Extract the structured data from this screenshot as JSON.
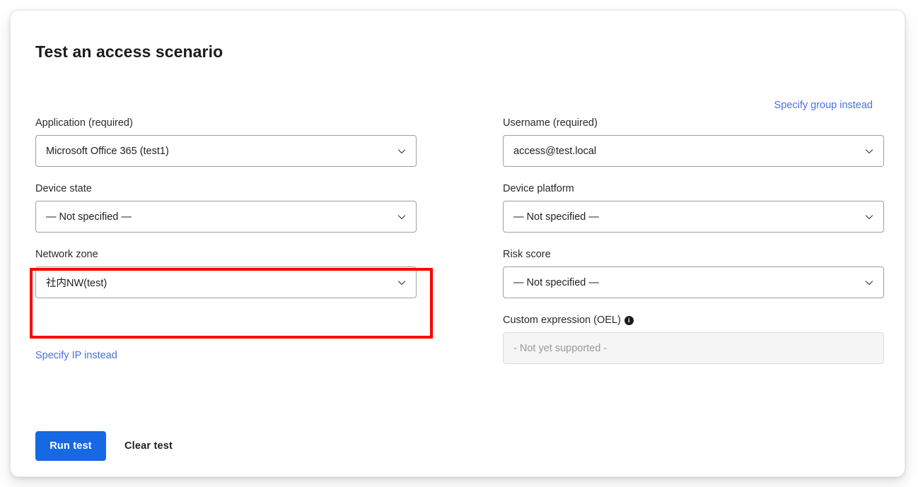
{
  "header": {
    "title": "Test an access scenario"
  },
  "links": {
    "specify_group": "Specify group instead",
    "specify_ip": "Specify IP instead"
  },
  "form": {
    "left_column": [
      {
        "label": "Application (required)",
        "value": "Microsoft Office 365 (test1)",
        "type": "select"
      },
      {
        "label": "Device state",
        "value": "— Not specified —",
        "type": "select"
      },
      {
        "label": "Network zone",
        "value": "社内NW(test)",
        "type": "select"
      }
    ],
    "right_column": [
      {
        "label": "Username (required)",
        "value": "access@test.local",
        "type": "select"
      },
      {
        "label": "Device platform",
        "value": "— Not specified —",
        "type": "select"
      },
      {
        "label": "Risk score",
        "value": "— Not specified —",
        "type": "select"
      },
      {
        "label": "Custom expression (OEL)",
        "value": "-  Not yet supported  -",
        "type": "disabled-input",
        "info_icon": "i"
      }
    ]
  },
  "actions": {
    "run_test": "Run test",
    "clear_test": "Clear test"
  },
  "highlight": {
    "target": "network-zone-field",
    "color": "#fe0000"
  },
  "colors": {
    "primary_button": "#1668e3",
    "link": "#4a6fe8",
    "highlight": "#fe0000",
    "input_border": "#a0a0a6",
    "text": "#1f1f1f"
  }
}
